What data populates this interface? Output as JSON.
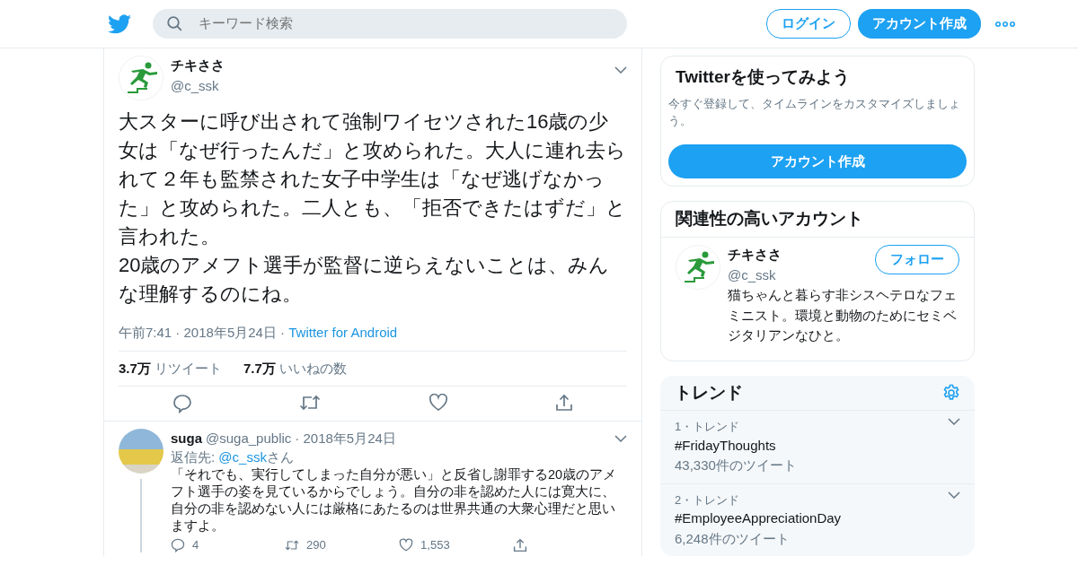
{
  "header": {
    "search_placeholder": "キーワード検索",
    "login": "ログイン",
    "signup": "アカウント作成"
  },
  "tweet": {
    "name": "チキささ",
    "handle": "@c_ssk",
    "text": "大スターに呼び出されて強制ワイセツされた16歳の少女は「なぜ行ったんだ」と攻められた。大人に連れ去られて２年も監禁された女子中学生は「なぜ逃げなかった」と攻められた。二人とも、「拒否できたはずだ」と言われた。\n20歳のアメフト選手が監督に逆らえないことは、みんな理解するのにね。",
    "time": "午前7:41 · 2018年5月24日 · ",
    "source": "Twitter for Android",
    "stats": [
      {
        "count": "3.7万",
        "label": "リツイート"
      },
      {
        "count": "7.7万",
        "label": "いいねの数"
      }
    ]
  },
  "replies": [
    {
      "name": "suga",
      "handle": "@suga_public",
      "date": "· 2018年5月24日",
      "reply_prefix": "返信先: ",
      "reply_to": "@c_ssk",
      "reply_suffix": "さん",
      "text": "「それでも、実行してしまった自分が悪い」と反省し謝罪する20歳のアメフト選手の姿を見ているからでしょう。自分の非を認めた人には寛大に、自分の非を認めない人には厳格にあたるのは世界共通の大衆心理だと思いますよ。",
      "counts": [
        "4",
        "290",
        "1,553"
      ]
    }
  ],
  "signup_card": {
    "title": "Twitterを使ってみよう",
    "text": "今すぐ登録して、タイムラインをカスタマイズしましょう。",
    "button": "アカウント作成"
  },
  "related": {
    "title": "関連性の高いアカウント",
    "accounts": [
      {
        "name": "チキささ",
        "handle": "@c_ssk",
        "bio": "猫ちゃんと暮らす非シスヘテロなフェミニスト。環境と動物のためにセミベジタリアンなひと。",
        "button": "フォロー"
      }
    ]
  },
  "trends": {
    "title": "トレンド",
    "items": [
      {
        "rank": "1・トレンド",
        "name": "#FridayThoughts",
        "count": "43,330件のツイート"
      },
      {
        "rank": "2・トレンド",
        "name": "#EmployeeAppreciationDay",
        "count": "6,248件のツイート"
      }
    ]
  }
}
